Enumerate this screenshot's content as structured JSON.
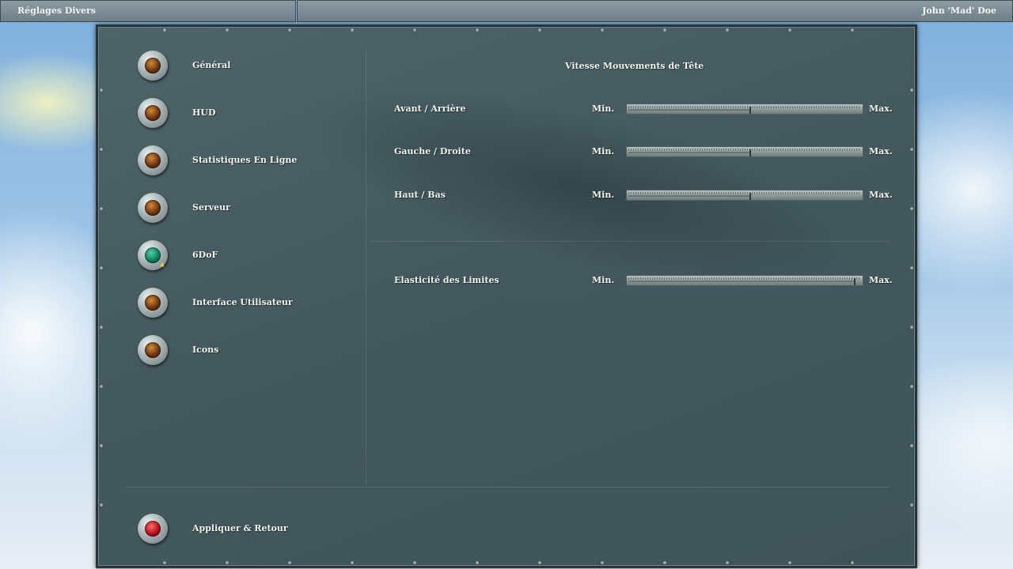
{
  "topbar": {
    "left_title": "Réglages Divers",
    "right_user": "John 'Mad' Doe"
  },
  "menu": {
    "items": [
      {
        "label": "Général",
        "led": "amber"
      },
      {
        "label": "HUD",
        "led": "amber"
      },
      {
        "label": "Statistiques En Ligne",
        "led": "amber"
      },
      {
        "label": "Serveur",
        "led": "amber"
      },
      {
        "label": "6DoF",
        "led": "green",
        "selected": true
      },
      {
        "label": "Interface Utilisateur",
        "led": "amber"
      },
      {
        "label": "Icons",
        "led": "amber"
      }
    ],
    "apply": {
      "label": "Appliquer & Retour",
      "led": "red"
    }
  },
  "content": {
    "section_title": "Vitesse Mouvements de Tête",
    "min_label": "Min.",
    "max_label": "Max.",
    "sliders": [
      {
        "label": "Avant / Arrière",
        "value": 0.52
      },
      {
        "label": "Gauche / Droite",
        "value": 0.52
      },
      {
        "label": "Haut / Bas",
        "value": 0.52
      },
      {
        "label": "Elasticité des Limites",
        "value": 0.97
      }
    ]
  },
  "colors": {
    "panel": "#43595e",
    "led_selected": "#117a5a",
    "led_apply": "#b3101b",
    "led_default": "#6b3410"
  }
}
